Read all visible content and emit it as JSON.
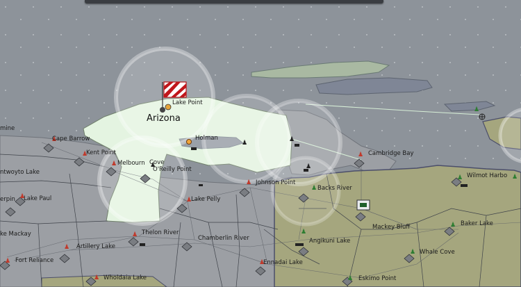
{
  "map": {
    "region_label": "Arizona",
    "places": {
      "mine": "mine",
      "cape_barrow": "Cape Barrow",
      "kent_point": "Kent Point",
      "ntwoyto_lake": "ntwoyto Lake",
      "melbourn": "Melbourn",
      "cove": "Cove",
      "oreilly_point": "O'Reilly Point",
      "erpin": "erpin",
      "lake_paul": "Lake Paul",
      "lake_pelly": "Lake Pelly",
      "johnson_point": "Johnson Point",
      "backs_river": "Backs River",
      "cambridge_bay": "Cambridge Bay",
      "wilmot_harbor": "Wilmot Harbo",
      "mackey_bluff": "Mackey Bluff",
      "baker_lake": "Baker Lake",
      "lake_mackay": "ke Mackay",
      "artillery_lake": "Artillery Lake",
      "thelon_river": "Thelon River",
      "chamberlin_river": "Chamberlin River",
      "angikuni_lake": "Angikuni Lake",
      "whale_cove": "Whale Cove",
      "fort_reliance": "Fort Reliance",
      "wholdaia_lake": "Wholdaia Lake",
      "ennadai_lake": "Ennadai Lake",
      "eskimo_point": "Eskimo Point",
      "lake_point": "Lake Point",
      "holman": "Holman"
    },
    "colors": {
      "sea": "#8d939a",
      "land_neutral": "#9c9fa4",
      "land_friendly": "#e4f4e1",
      "land_enemy": "#a5a67e",
      "water_inland": "#7f8696"
    }
  }
}
